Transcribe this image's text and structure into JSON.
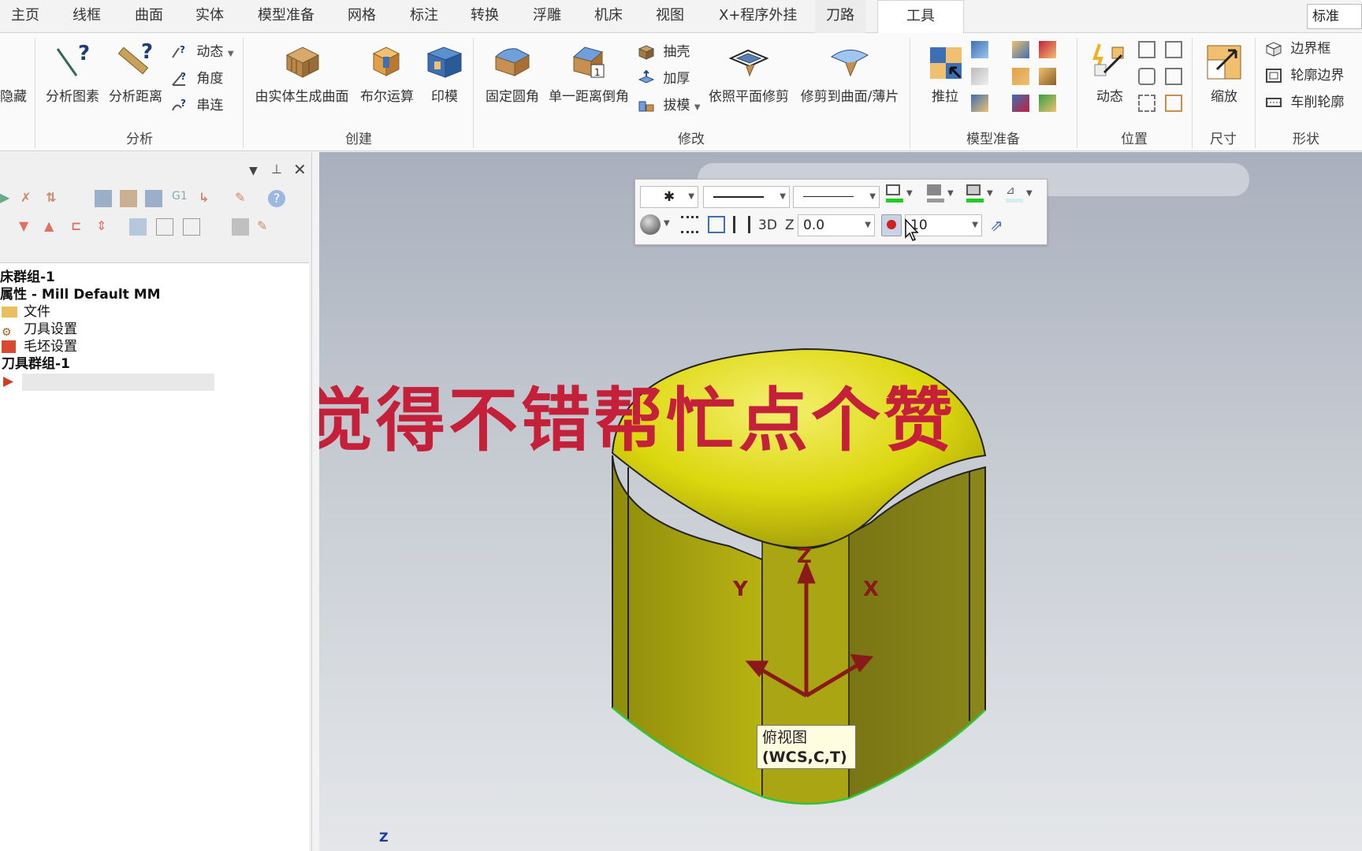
{
  "tabs": [
    {
      "label": "主页"
    },
    {
      "label": "线框"
    },
    {
      "label": "曲面"
    },
    {
      "label": "实体"
    },
    {
      "label": "模型准备"
    },
    {
      "label": "网格"
    },
    {
      "label": "标注"
    },
    {
      "label": "转换"
    },
    {
      "label": "浮雕"
    },
    {
      "label": "机床"
    },
    {
      "label": "视图"
    },
    {
      "label": "X+程序外挂"
    },
    {
      "label": "刀路"
    },
    {
      "label": "工具"
    }
  ],
  "style_select": "标准",
  "ribbon": {
    "hide_label": "隐藏",
    "analyze": {
      "group": "分析",
      "analyze_entity": "分析图素",
      "analyze_distance": "分析距离",
      "dynamic": "动态",
      "angle": "角度",
      "chain": "串连"
    },
    "create": {
      "group": "创建",
      "surface_from_solid": "由实体生成曲面",
      "boolean": "布尔运算",
      "imprint": "印模"
    },
    "modify": {
      "group": "修改",
      "fixed_fillet": "固定圆角",
      "chamfer": "单一距离倒角",
      "shell": "抽壳",
      "thicken": "加厚",
      "draft": "拔模",
      "trim_plane": "依照平面修剪",
      "trim_surface": "修剪到曲面/薄片"
    },
    "model_prep": {
      "group": "模型准备",
      "push_pull": "推拉"
    },
    "position": {
      "group": "位置",
      "dynamic": "动态"
    },
    "size": {
      "group": "尺寸",
      "scale": "缩放"
    },
    "shape": {
      "group": "形状",
      "bounding_box": "边界框",
      "silhouette": "轮廓边界",
      "turn_profile": "车削轮廓"
    }
  },
  "tree": {
    "machine_group": "床群组-1",
    "properties": "属性 - Mill Default MM",
    "files": "文件",
    "tool_settings": "刀具设置",
    "stock_settings": "毛坯设置",
    "toolpath_group": "刀具群组-1"
  },
  "attr_toolbar": {
    "mode_3d": "3D",
    "z_label": "Z",
    "z_value": "0.0",
    "level_value": "10"
  },
  "axes": {
    "x": "X",
    "y": "Y",
    "z": "Z",
    "small_z": "Z"
  },
  "watermark": "觉得不错帮忙点个赞",
  "tooltip": {
    "line1": "俯视图",
    "line2": "(WCS,C,T)"
  },
  "colors": {
    "accent_red": "#c4203a",
    "model_yellow": "#dcd70e",
    "edge_green": "#34c43a"
  }
}
